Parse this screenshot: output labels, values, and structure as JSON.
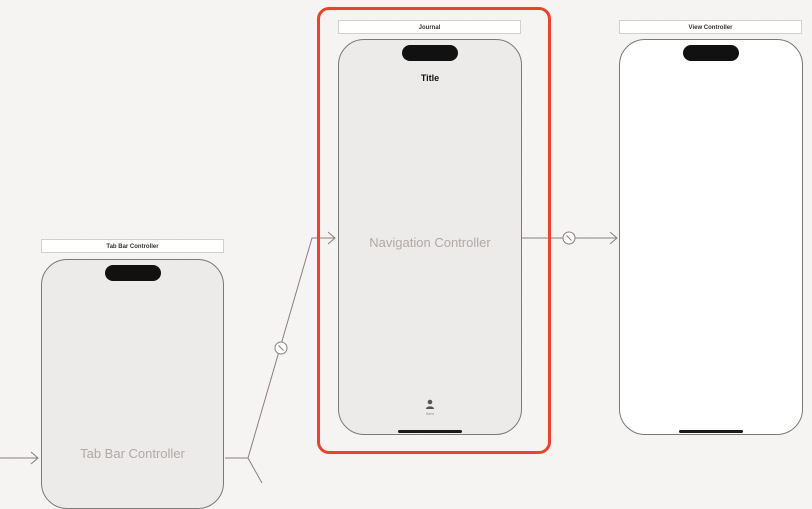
{
  "scenes": {
    "tab_bar": {
      "label": "Tab Bar Controller",
      "center_text": "Tab Bar Controller"
    },
    "journal": {
      "label": "Journal",
      "nav_title": "Title",
      "center_text": "Navigation Controller",
      "tab_item_icon": "person-icon",
      "tab_item_label": "Item"
    },
    "view_controller": {
      "label": "View Controller"
    }
  },
  "colors": {
    "selection": "#e8432f",
    "connector": "#8a7e7c",
    "placeholder_text": "#b2a8a6"
  },
  "icons": [
    "segue-icon",
    "arrow-icon",
    "person-icon"
  ]
}
